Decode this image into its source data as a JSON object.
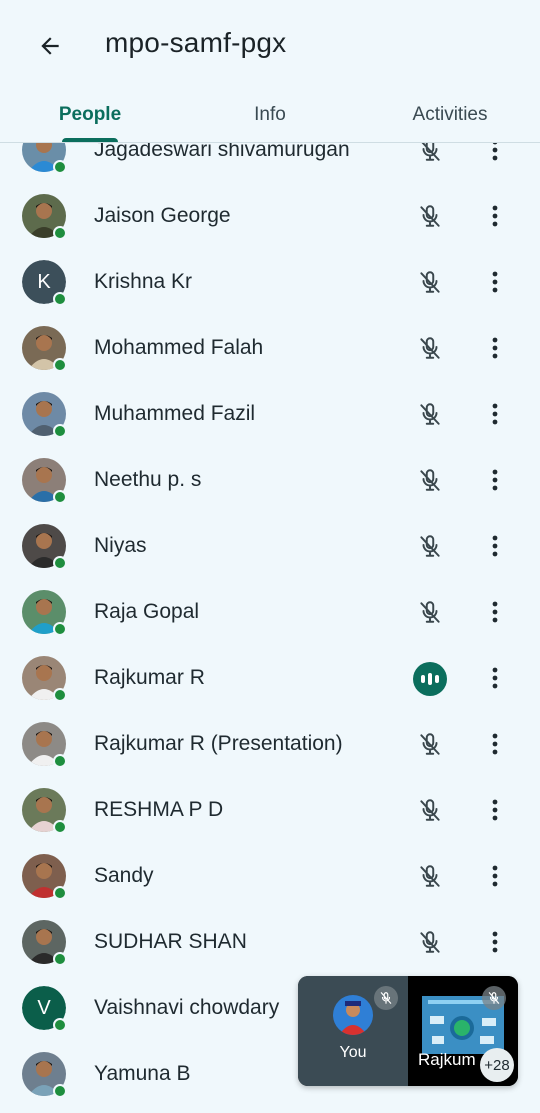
{
  "header": {
    "title": "mpo-samf-pgx",
    "back_icon": "arrow-back-icon"
  },
  "tabs": [
    {
      "label": "People",
      "active": true
    },
    {
      "label": "Info",
      "active": false
    },
    {
      "label": "Activities",
      "active": false
    }
  ],
  "participants": [
    {
      "name": "Jagadeswari shivamurugan",
      "avatar": "photo",
      "mic": "muted"
    },
    {
      "name": "Jaison George",
      "avatar": "photo",
      "mic": "muted"
    },
    {
      "name": "Krishna Kr",
      "avatar": "letter",
      "letter": "K",
      "avatar_color": "#3c4f5a",
      "mic": "muted"
    },
    {
      "name": "Mohammed Falah",
      "avatar": "photo",
      "mic": "muted"
    },
    {
      "name": "Muhammed Fazil",
      "avatar": "photo",
      "mic": "muted"
    },
    {
      "name": "Neethu p. s",
      "avatar": "photo",
      "mic": "muted"
    },
    {
      "name": "Niyas",
      "avatar": "photo",
      "mic": "muted"
    },
    {
      "name": "Raja Gopal",
      "avatar": "photo",
      "mic": "muted"
    },
    {
      "name": "Rajkumar R",
      "avatar": "photo",
      "mic": "speaking"
    },
    {
      "name": "Rajkumar R (Presentation)",
      "avatar": "photo",
      "mic": "muted"
    },
    {
      "name": "RESHMA P D",
      "avatar": "photo",
      "mic": "muted"
    },
    {
      "name": "Sandy",
      "avatar": "photo",
      "mic": "muted"
    },
    {
      "name": "SUDHAR SHAN",
      "avatar": "photo",
      "mic": "muted"
    },
    {
      "name": "Vaishnavi chowdary",
      "avatar": "letter",
      "letter": "V",
      "avatar_color": "#0b5e4a",
      "mic": "muted"
    },
    {
      "name": "Yamuna B",
      "avatar": "photo",
      "mic": "muted"
    }
  ],
  "pip": {
    "you_label": "You",
    "other_label": "Rajkum",
    "more_count": "+28"
  },
  "colors": {
    "accent": "#0b6e5d",
    "presence": "#1e8e3e",
    "background": "#f0f8fc"
  }
}
